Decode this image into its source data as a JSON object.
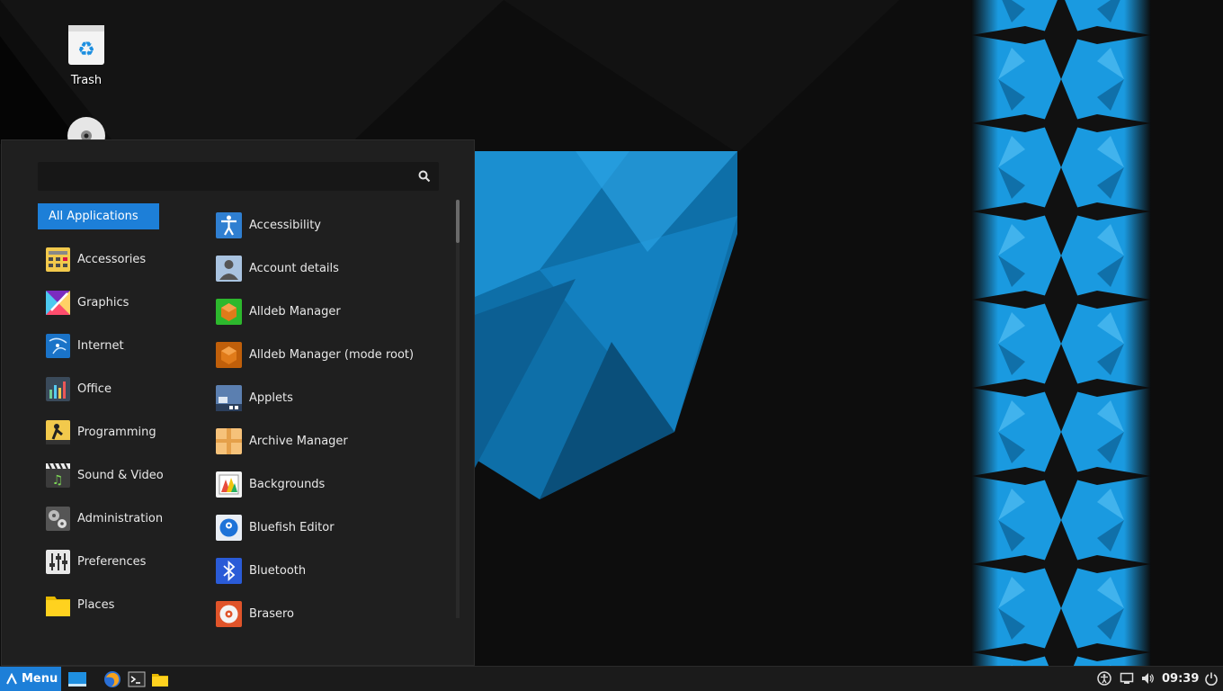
{
  "desktop": {
    "icons": [
      {
        "label": "Trash",
        "icon": "trash-icon"
      },
      {
        "label": "",
        "icon": "optical-disc-icon"
      }
    ]
  },
  "menu": {
    "search": {
      "value": "",
      "placeholder": ""
    },
    "categories": [
      {
        "label": "All Applications",
        "selected": true
      },
      {
        "label": "Accessories",
        "icon": "accessories-icon"
      },
      {
        "label": "Graphics",
        "icon": "graphics-icon"
      },
      {
        "label": "Internet",
        "icon": "internet-icon"
      },
      {
        "label": "Office",
        "icon": "office-icon"
      },
      {
        "label": "Programming",
        "icon": "programming-icon"
      },
      {
        "label": "Sound & Video",
        "icon": "sound-video-icon"
      },
      {
        "label": "Administration",
        "icon": "administration-icon"
      },
      {
        "label": "Preferences",
        "icon": "preferences-icon"
      },
      {
        "label": "Places",
        "icon": "places-folder-icon"
      }
    ],
    "apps": [
      {
        "label": "Accessibility",
        "icon": "accessibility-icon"
      },
      {
        "label": "Account details",
        "icon": "account-details-icon"
      },
      {
        "label": "Alldeb Manager",
        "icon": "alldeb-manager-icon"
      },
      {
        "label": "Alldeb Manager (mode root)",
        "icon": "alldeb-manager-root-icon"
      },
      {
        "label": "Applets",
        "icon": "applets-icon"
      },
      {
        "label": "Archive Manager",
        "icon": "archive-manager-icon"
      },
      {
        "label": "Backgrounds",
        "icon": "backgrounds-icon"
      },
      {
        "label": "Bluefish Editor",
        "icon": "bluefish-editor-icon"
      },
      {
        "label": "Bluetooth",
        "icon": "bluetooth-icon"
      },
      {
        "label": "Brasero",
        "icon": "brasero-icon"
      }
    ]
  },
  "taskbar": {
    "menu_label": "Menu",
    "clock": "09:39",
    "launchers": [
      "show-desktop-icon",
      "firefox-icon",
      "terminal-icon",
      "files-folder-icon"
    ],
    "tray": [
      "accessibility-tray-icon",
      "network-icon",
      "volume-icon",
      "power-icon"
    ]
  },
  "colors": {
    "accent": "#1d7fd8",
    "menu_bg": "#1f1f1f",
    "taskbar_bg": "#1b1b1b"
  }
}
